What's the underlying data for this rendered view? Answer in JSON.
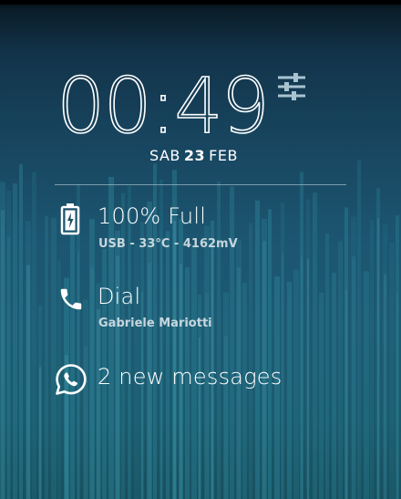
{
  "lockscreen": {
    "clock": {
      "hours": "00",
      "separator": ":",
      "minutes": "49"
    },
    "date": {
      "weekday": "SAB",
      "day": "23",
      "month": "FEB"
    },
    "settings_icon": "sliders-icon"
  },
  "notifications": {
    "battery": {
      "icon": "battery-icon",
      "title": "100% Full",
      "detail": "USB - 33°C - 4162mV",
      "level": 1.0
    },
    "dial": {
      "icon": "phone-icon",
      "title": "Dial",
      "detail": "Gabriele Mariotti"
    },
    "whatsapp": {
      "icon": "whatsapp-icon",
      "title": "2 new messages"
    }
  },
  "theme": {
    "accent_bar_color": "#2a7f93",
    "text_color": "#ffffff"
  }
}
